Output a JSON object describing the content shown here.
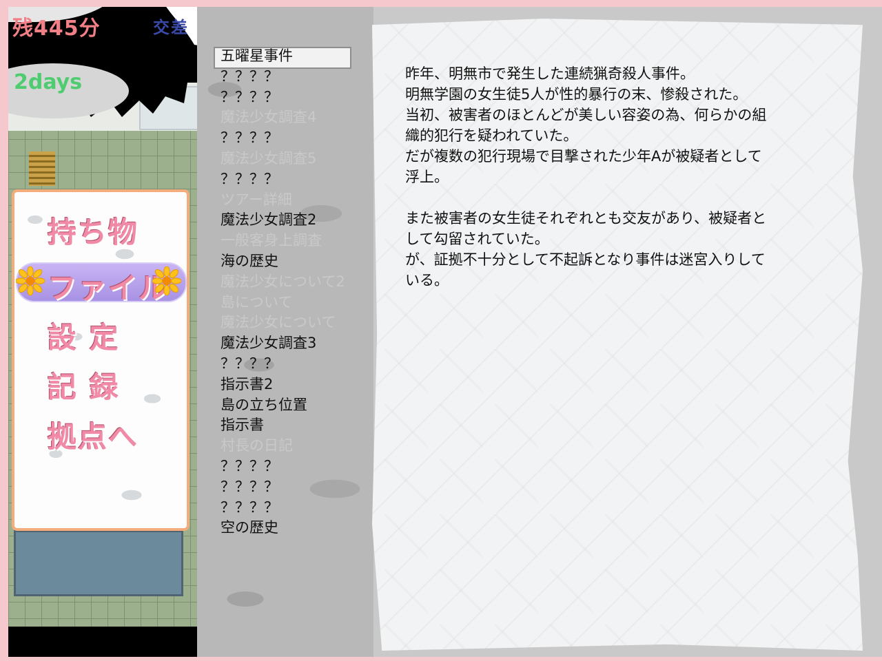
{
  "hud": {
    "time_remaining": "残445分",
    "weather": "交差",
    "day_count": "2days"
  },
  "menu": {
    "items": [
      "持ち物",
      "ファイル",
      "設 定",
      "記 録",
      "拠点へ"
    ],
    "selected_index": 1
  },
  "file_list": [
    {
      "label": "五曜星事件",
      "state": "selected"
    },
    {
      "label": "？？？？",
      "state": "normal"
    },
    {
      "label": "？？？？",
      "state": "normal"
    },
    {
      "label": "魔法少女調査4",
      "state": "dim"
    },
    {
      "label": "？？？？",
      "state": "normal"
    },
    {
      "label": "魔法少女調査5",
      "state": "dim"
    },
    {
      "label": "？？？？",
      "state": "normal"
    },
    {
      "label": "ツアー詳細",
      "state": "dim"
    },
    {
      "label": "魔法少女調査2",
      "state": "normal"
    },
    {
      "label": "一般客身上調査",
      "state": "dim"
    },
    {
      "label": "海の歴史",
      "state": "normal"
    },
    {
      "label": "魔法少女について2",
      "state": "dim"
    },
    {
      "label": "島について",
      "state": "dim"
    },
    {
      "label": "魔法少女について",
      "state": "dim"
    },
    {
      "label": "魔法少女調査3",
      "state": "normal"
    },
    {
      "label": "？？？？",
      "state": "normal"
    },
    {
      "label": "指示書2",
      "state": "normal"
    },
    {
      "label": "島の立ち位置",
      "state": "normal"
    },
    {
      "label": "指示書",
      "state": "normal"
    },
    {
      "label": "村長の日記",
      "state": "dim"
    },
    {
      "label": "？？？？",
      "state": "normal"
    },
    {
      "label": "？？？？",
      "state": "normal"
    },
    {
      "label": "？？？？",
      "state": "normal"
    },
    {
      "label": "空の歴史",
      "state": "normal"
    }
  ],
  "document": {
    "lines": [
      "昨年、明無市で発生した連続猟奇殺人事件。",
      "明無学園の女生徒5人が性的暴行の末、惨殺された。",
      "当初、被害者のほとんどが美しい容姿の為、何らかの組",
      "織的犯行を疑われていた。",
      "だが複数の犯行現場で目撃された少年Aが被疑者として",
      "浮上。",
      "",
      "また被害者の女生徒それぞれとも交友があり、被疑者と",
      "して勾留されていた。",
      "が、証拠不十分として不起訴となり事件は迷宮入りして",
      "いる。"
    ]
  },
  "colors": {
    "menu_text": "#f08aa6",
    "menu_border": "#f5ac7c",
    "selected_pill": "#b9a4ec",
    "time_text": "#f07f86",
    "day_text": "#4fcc70",
    "weather_text": "#3a4aa8",
    "dim_text": "#c9c9c9"
  }
}
